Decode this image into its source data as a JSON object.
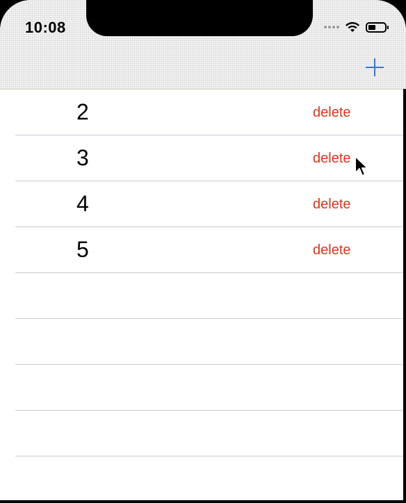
{
  "status_bar": {
    "time": "10:08"
  },
  "nav": {
    "add_icon": "plus-icon",
    "accent_color": "#1a7cf5"
  },
  "rows": [
    {
      "value": "2",
      "action": "delete"
    },
    {
      "value": "3",
      "action": "delete"
    },
    {
      "value": "4",
      "action": "delete"
    },
    {
      "value": "5",
      "action": "delete"
    }
  ],
  "empty_rows": 5,
  "colors": {
    "delete": "#e0321c",
    "separator": "#c8ccd4"
  }
}
